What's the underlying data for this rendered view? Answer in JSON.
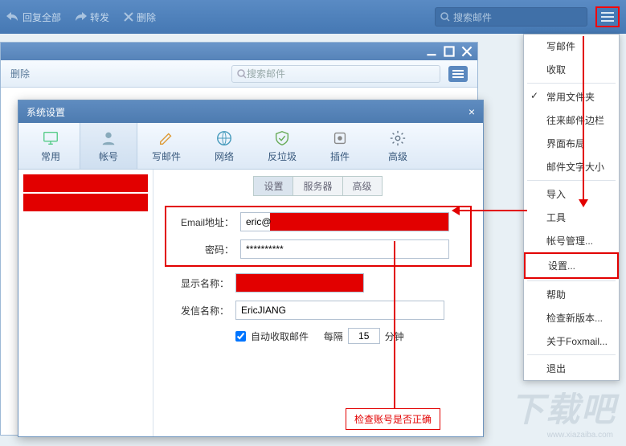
{
  "toolbar": {
    "reply_all": "回复全部",
    "forward": "转发",
    "delete": "删除",
    "search_placeholder": "搜索邮件"
  },
  "inner": {
    "delete": "删除",
    "search_placeholder": "搜索邮件"
  },
  "dialog": {
    "title": "系统设置",
    "tabs": {
      "general": "常用",
      "account": "帐号",
      "compose": "写邮件",
      "network": "网络",
      "antispam": "反垃圾",
      "plugin": "插件",
      "advanced": "高级"
    },
    "sub": {
      "settings": "设置",
      "server": "服务器",
      "advanced": "高级"
    },
    "fields": {
      "email_label": "Email地址：",
      "email_value": "eric@",
      "password_label": "密码：",
      "password_value": "**********",
      "display_label": "显示名称：",
      "display_value": "",
      "sender_label": "发信名称：",
      "sender_value": "EricJIANG",
      "auto_fetch": "自动收取邮件",
      "every": "每隔",
      "interval": "15",
      "minutes": "分钟"
    }
  },
  "menu": {
    "compose": "写邮件",
    "receive": "收取",
    "fav": "常用文件夹",
    "remote": "往来邮件边栏",
    "layout": "界面布局",
    "fontsize": "邮件文字大小",
    "import": "导入",
    "tools": "工具",
    "acct_mgmt": "帐号管理...",
    "settings": "设置...",
    "help": "帮助",
    "update": "检查新版本...",
    "about": "关于Foxmail...",
    "exit": "退出"
  },
  "callout": "检查账号是否正确",
  "watermark": "下载吧",
  "watermark_url": "www.xiazaiba.com"
}
